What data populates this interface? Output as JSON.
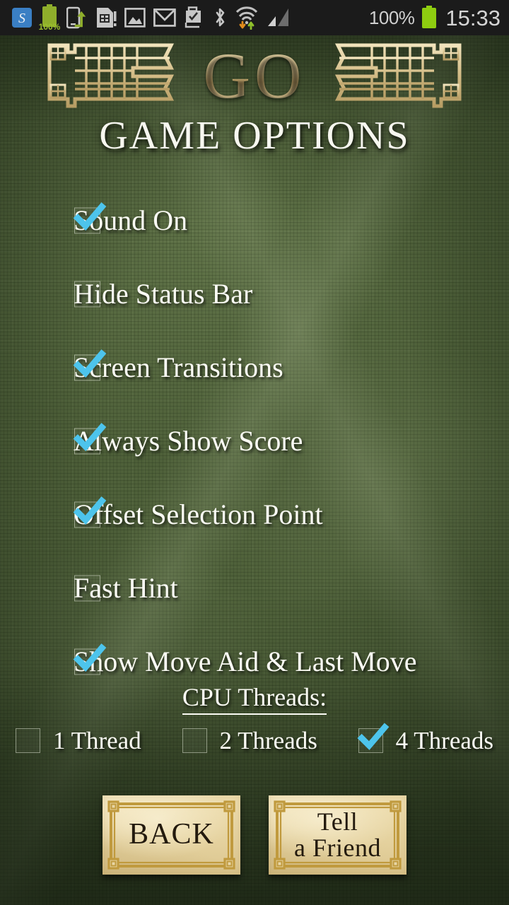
{
  "statusbar": {
    "icons": [
      {
        "name": "skype-app-icon",
        "glyph": "S"
      },
      {
        "name": "battery-charge-icon",
        "label": "100%"
      },
      {
        "name": "phone-transfer-icon"
      },
      {
        "name": "sim-card-alert-icon"
      },
      {
        "name": "gallery-image-icon"
      },
      {
        "name": "gmail-mail-icon"
      },
      {
        "name": "briefcase-check-icon"
      },
      {
        "name": "bluetooth-icon"
      },
      {
        "name": "wifi-data-transfer-icon"
      },
      {
        "name": "cellular-signal-icon"
      }
    ],
    "battery_percent": "100%",
    "clock": "15:33"
  },
  "header": {
    "logo_text": "GO",
    "logo_ornament": "go-board-lattice-icon",
    "page_title": "GAME OPTIONS"
  },
  "options": [
    {
      "label": "Sound On",
      "checked": true
    },
    {
      "label": "Hide Status Bar",
      "checked": false
    },
    {
      "label": "Screen Transitions",
      "checked": true
    },
    {
      "label": "Always Show Score",
      "checked": true
    },
    {
      "label": "Offset Selection Point",
      "checked": true
    },
    {
      "label": "Fast Hint",
      "checked": false
    },
    {
      "label": "Show Move Aid & Last Move",
      "checked": true
    }
  ],
  "cpu_threads": {
    "heading": "CPU Threads:",
    "choices": [
      {
        "label": "1 Thread",
        "checked": false
      },
      {
        "label": "2 Threads",
        "checked": false
      },
      {
        "label": "4 Threads",
        "checked": true
      }
    ]
  },
  "buttons": {
    "back": "BACK",
    "tell_a_friend": "Tell\na Friend"
  },
  "colors": {
    "check_cyan": "#4DC4EC",
    "background_green": "#55683f",
    "gold": "#d9c189",
    "parchment": "#e8d6a6",
    "text_white": "#fbfbf4",
    "button_text": "#231a0e",
    "statusbar_bg": "#1b1b1b",
    "battery_green": "#9bcd1e"
  }
}
